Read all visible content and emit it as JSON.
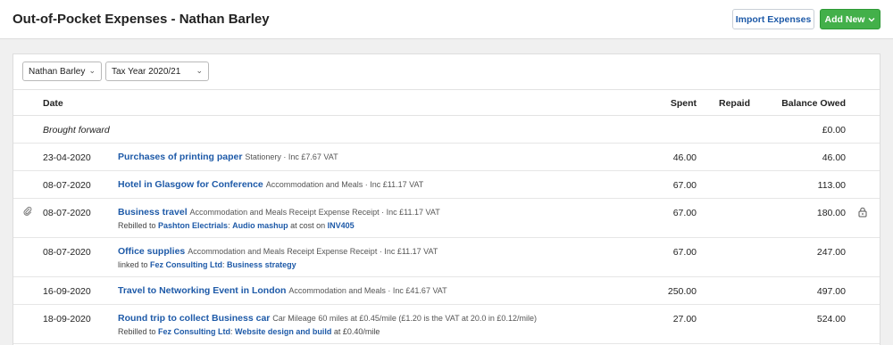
{
  "page": {
    "title": "Out-of-Pocket Expenses - Nathan Barley",
    "import_label": "Import Expenses",
    "add_label": "Add New",
    "add_chevron": "⌄"
  },
  "filters": {
    "person": "Nathan Barley",
    "period": "Tax Year 2020/21"
  },
  "columns": {
    "date": "Date",
    "spent": "Spent",
    "repaid": "Repaid",
    "balance": "Balance Owed"
  },
  "brought_forward": {
    "label": "Brought forward",
    "balance": "£0.00"
  },
  "rows": [
    {
      "date": "23-04-2020",
      "title": "Purchases of printing paper",
      "meta": "Stationery · Inc £7.67 VAT",
      "spent": "46.00",
      "balance": "46.00"
    },
    {
      "date": "08-07-2020",
      "title": "Hotel in Glasgow for Conference",
      "meta": "Accommodation and Meals · Inc £11.17 VAT",
      "spent": "67.00",
      "balance": "113.00"
    },
    {
      "date": "08-07-2020",
      "title": "Business travel",
      "meta": "Accommodation and Meals Receipt Expense Receipt · Inc £11.17 VAT",
      "sub_prefix": "Rebilled to ",
      "sub_link1": "Pashton Electrials",
      "sub_sep": ": ",
      "sub_link2": "Audio mashup",
      "sub_mid": " at cost on ",
      "sub_link3": "INV405",
      "spent": "67.00",
      "balance": "180.00",
      "has_attachment": true,
      "locked": true
    },
    {
      "date": "08-07-2020",
      "title": "Office supplies",
      "meta": "Accommodation and Meals Receipt Expense Receipt · Inc £11.17 VAT",
      "sub_prefix": "linked to ",
      "sub_link1": "Fez Consulting Ltd",
      "sub_sep": ": ",
      "sub_link2": "Business strategy",
      "spent": "67.00",
      "balance": "247.00"
    },
    {
      "date": "16-09-2020",
      "title": "Travel to Networking Event in London",
      "meta": "Accommodation and Meals · Inc £41.67 VAT",
      "spent": "250.00",
      "balance": "497.00"
    },
    {
      "date": "18-09-2020",
      "title": "Round trip to collect Business car",
      "meta": "Car Mileage 60 miles at £0.45/mile (£1.20 is the VAT at 20.0 in £0.12/mile)",
      "sub_prefix": "Rebilled to ",
      "sub_link1": "Fez Consulting Ltd",
      "sub_sep": ": ",
      "sub_link2": "Website design and build",
      "sub_mid": " at £0.40/mile",
      "spent": "27.00",
      "balance": "524.00"
    }
  ],
  "icons": {
    "chevron": "⌄",
    "paperclip": "paperclip-icon",
    "lock": "lock-icon"
  }
}
